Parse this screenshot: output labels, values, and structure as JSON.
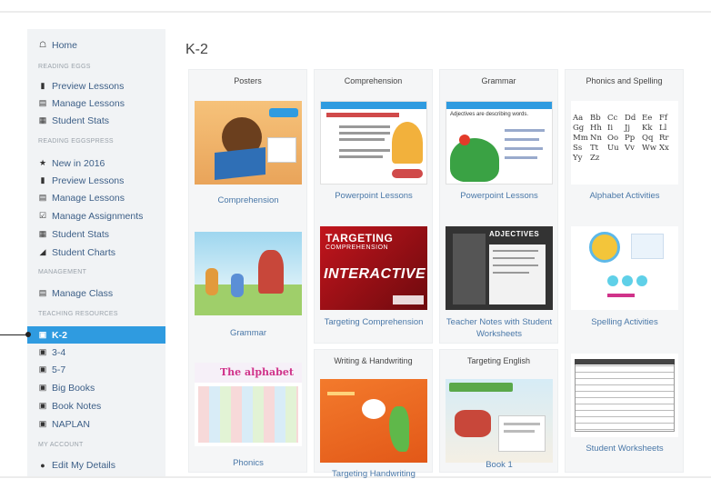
{
  "sidebar": {
    "home": "Home",
    "headings": {
      "reading_eggs": "READING EGGS",
      "reading_eggspress": "READING EGGSPRESS",
      "management": "MANAGEMENT",
      "teaching_resources": "TEACHING RESOURCES",
      "my_account": "MY ACCOUNT"
    },
    "reading_eggs_items": [
      "Preview Lessons",
      "Manage Lessons",
      "Student Stats"
    ],
    "eggspress_items": [
      "New in 2016",
      "Preview Lessons",
      "Manage Lessons",
      "Manage Assignments",
      "Student Stats",
      "Student Charts"
    ],
    "management_items": [
      "Manage Class"
    ],
    "resources_items": [
      "K-2",
      "3-4",
      "5-7",
      "Big Books",
      "Book Notes",
      "NAPLAN"
    ],
    "account_items": [
      "Edit My Details"
    ],
    "active_item": "K-2"
  },
  "main": {
    "title": "K-2",
    "panels": {
      "posters": {
        "title": "Posters",
        "cards": [
          "Comprehension",
          "Grammar",
          "Phonics"
        ],
        "phonics_banner": "The alphabet"
      },
      "comprehension": {
        "title": "Comprehension",
        "cards": [
          "Powerpoint Lessons",
          "Targeting Comprehension"
        ],
        "thumb_line1": "TARGETING",
        "thumb_line2": "COMPREHENSION",
        "thumb_line3": "INTERACTIVE"
      },
      "grammar": {
        "title": "Grammar",
        "cards": [
          "Powerpoint Lessons",
          "Teacher Notes with Student Worksheets"
        ],
        "thumb_adjectives": "ADJECTIVES",
        "thumb_frog_text": "Adjectives are describing words."
      },
      "phonics_spelling": {
        "title": "Phonics and Spelling",
        "cards": [
          "Alphabet Activities",
          "Spelling Activities",
          "Student Worksheets"
        ],
        "alphabet": [
          "Aa",
          "Bb",
          "Cc",
          "Dd",
          "Ee",
          "Ff",
          "Gg",
          "Hh",
          "Ii",
          "Jj",
          "Kk",
          "Ll",
          "Mm",
          "Nn",
          "Oo",
          "Pp",
          "Qq",
          "Rr",
          "Ss",
          "Tt",
          "Uu",
          "Vv",
          "Ww",
          "Xx",
          "Yy",
          "Zz"
        ]
      },
      "writing": {
        "title": "Writing & Handwriting",
        "cards": [
          "Targeting Handwriting"
        ]
      },
      "targeting_english": {
        "title": "Targeting English",
        "cards": [
          "Book 1"
        ]
      }
    }
  },
  "colors": {
    "accent": "#2f9be0",
    "link": "#4a78a8",
    "sidebar_bg": "#f1f3f5",
    "panel_bg": "#f5f6f7"
  }
}
